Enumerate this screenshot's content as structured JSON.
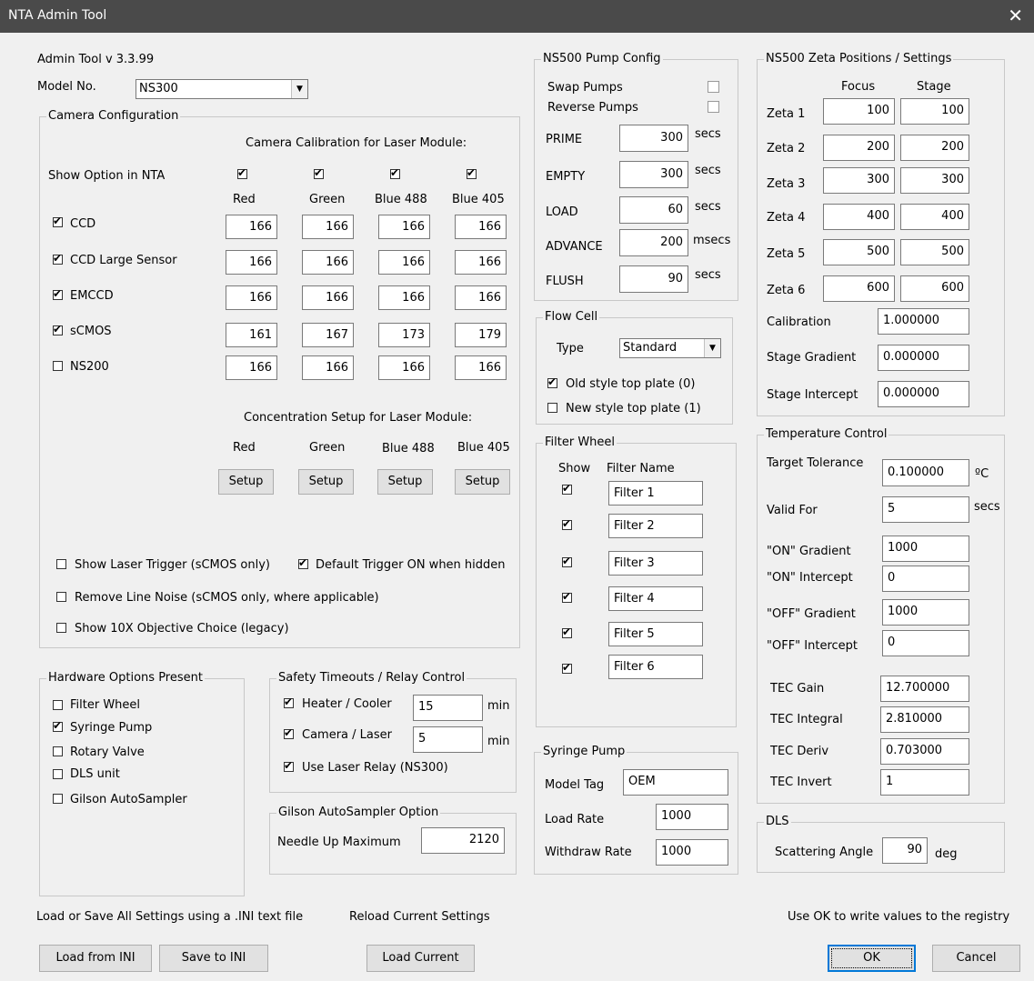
{
  "window": {
    "title": "NTA Admin Tool"
  },
  "header": {
    "version": "Admin Tool v 3.3.99",
    "model_label": "Model No.",
    "model_value": "NS300"
  },
  "camera": {
    "group": "Camera Configuration",
    "calib_title": "Camera Calibration for Laser Module:",
    "show_option": "Show Option in NTA",
    "columns": [
      "Red",
      "Green",
      "Blue 488",
      "Blue 405"
    ],
    "rows": [
      {
        "label": "CCD",
        "values": [
          "166",
          "166",
          "166",
          "166"
        ]
      },
      {
        "label": "CCD Large Sensor",
        "values": [
          "166",
          "166",
          "166",
          "166"
        ]
      },
      {
        "label": "EMCCD",
        "values": [
          "166",
          "166",
          "166",
          "166"
        ]
      },
      {
        "label": "sCMOS",
        "values": [
          "161",
          "167",
          "173",
          "179"
        ]
      },
      {
        "label": "NS200",
        "values": [
          "166",
          "166",
          "166",
          "166"
        ]
      }
    ],
    "conc_title": "Concentration Setup for Laser Module:",
    "setup_label": "Setup",
    "opt_laser_trigger": "Show Laser Trigger (sCMOS only)",
    "opt_default_trigger": "Default Trigger ON when hidden",
    "opt_line_noise": "Remove Line Noise (sCMOS only, where applicable)",
    "opt_10x": "Show 10X Objective Choice (legacy)"
  },
  "pump": {
    "group": "NS500 Pump Config",
    "swap": "Swap Pumps",
    "reverse": "Reverse Pumps",
    "rows": [
      {
        "label": "PRIME",
        "value": "300",
        "unit": "secs"
      },
      {
        "label": "EMPTY",
        "value": "300",
        "unit": "secs"
      },
      {
        "label": "LOAD",
        "value": "60",
        "unit": "secs"
      },
      {
        "label": "ADVANCE",
        "value": "200",
        "unit": "msecs"
      },
      {
        "label": "FLUSH",
        "value": "90",
        "unit": "secs"
      }
    ]
  },
  "flowcell": {
    "group": "Flow Cell",
    "type_label": "Type",
    "type_value": "Standard",
    "old": "Old style top plate (0)",
    "new": "New style top plate (1)"
  },
  "filter": {
    "group": "Filter Wheel",
    "show": "Show",
    "name": "Filter Name",
    "items": [
      "Filter 1",
      "Filter 2",
      "Filter 3",
      "Filter 4",
      "Filter 5",
      "Filter 6"
    ]
  },
  "syringe": {
    "group": "Syringe Pump",
    "model_label": "Model Tag",
    "model_value": "OEM",
    "load_label": "Load Rate",
    "load_value": "1000",
    "withdraw_label": "Withdraw Rate",
    "withdraw_value": "1000"
  },
  "zeta": {
    "group": "NS500 Zeta Positions / Settings",
    "focus": "Focus",
    "stage": "Stage",
    "rows": [
      {
        "label": "Zeta 1",
        "focus": "100",
        "stage": "100"
      },
      {
        "label": "Zeta 2",
        "focus": "200",
        "stage": "200"
      },
      {
        "label": "Zeta 3",
        "focus": "300",
        "stage": "300"
      },
      {
        "label": "Zeta 4",
        "focus": "400",
        "stage": "400"
      },
      {
        "label": "Zeta 5",
        "focus": "500",
        "stage": "500"
      },
      {
        "label": "Zeta 6",
        "focus": "600",
        "stage": "600"
      }
    ],
    "calib_label": "Calibration",
    "calib_value": "1.000000",
    "grad_label": "Stage Gradient",
    "grad_value": "0.000000",
    "int_label": "Stage Intercept",
    "int_value": "0.000000"
  },
  "temp": {
    "group": "Temperature Control",
    "tol_label": "Target Tolerance",
    "tol_value": "0.100000",
    "tol_unit": "ºC",
    "valid_label": "Valid For",
    "valid_value": "5",
    "valid_unit": "secs",
    "on_grad_label": "\"ON\" Gradient",
    "on_grad_value": "1000",
    "on_int_label": "\"ON\" Intercept",
    "on_int_value": "0",
    "off_grad_label": "\"OFF\" Gradient",
    "off_grad_value": "1000",
    "off_int_label": "\"OFF\" Intercept",
    "off_int_value": "0",
    "tec_gain_label": "TEC Gain",
    "tec_gain_value": "12.700000",
    "tec_int_label": "TEC Integral",
    "tec_int_value": "2.810000",
    "tec_deriv_label": "TEC Deriv",
    "tec_deriv_value": "0.703000",
    "tec_inv_label": "TEC Invert",
    "tec_inv_value": "1"
  },
  "dls": {
    "group": "DLS",
    "angle_label": "Scattering Angle",
    "angle_value": "90",
    "angle_unit": "deg"
  },
  "hardware": {
    "group": "Hardware Options Present",
    "items": [
      "Filter Wheel",
      "Syringe Pump",
      "Rotary Valve",
      "DLS unit",
      "Gilson AutoSampler"
    ]
  },
  "safety": {
    "group": "Safety Timeouts / Relay Control",
    "heater_label": "Heater / Cooler",
    "heater_value": "15",
    "camera_label": "Camera / Laser",
    "camera_value": "5",
    "unit": "min",
    "relay_label": "Use Laser Relay (NS300)"
  },
  "gilson": {
    "group": "Gilson AutoSampler Option",
    "needle_label": "Needle Up Maximum",
    "needle_value": "2120"
  },
  "footer": {
    "ini_text": "Load or Save All Settings using a .INI text file",
    "reload_text": "Reload Current Settings",
    "ok_text": "Use OK to write values to the registry",
    "load_ini": "Load from INI",
    "save_ini": "Save to INI",
    "load_current": "Load Current",
    "ok": "OK",
    "cancel": "Cancel"
  }
}
